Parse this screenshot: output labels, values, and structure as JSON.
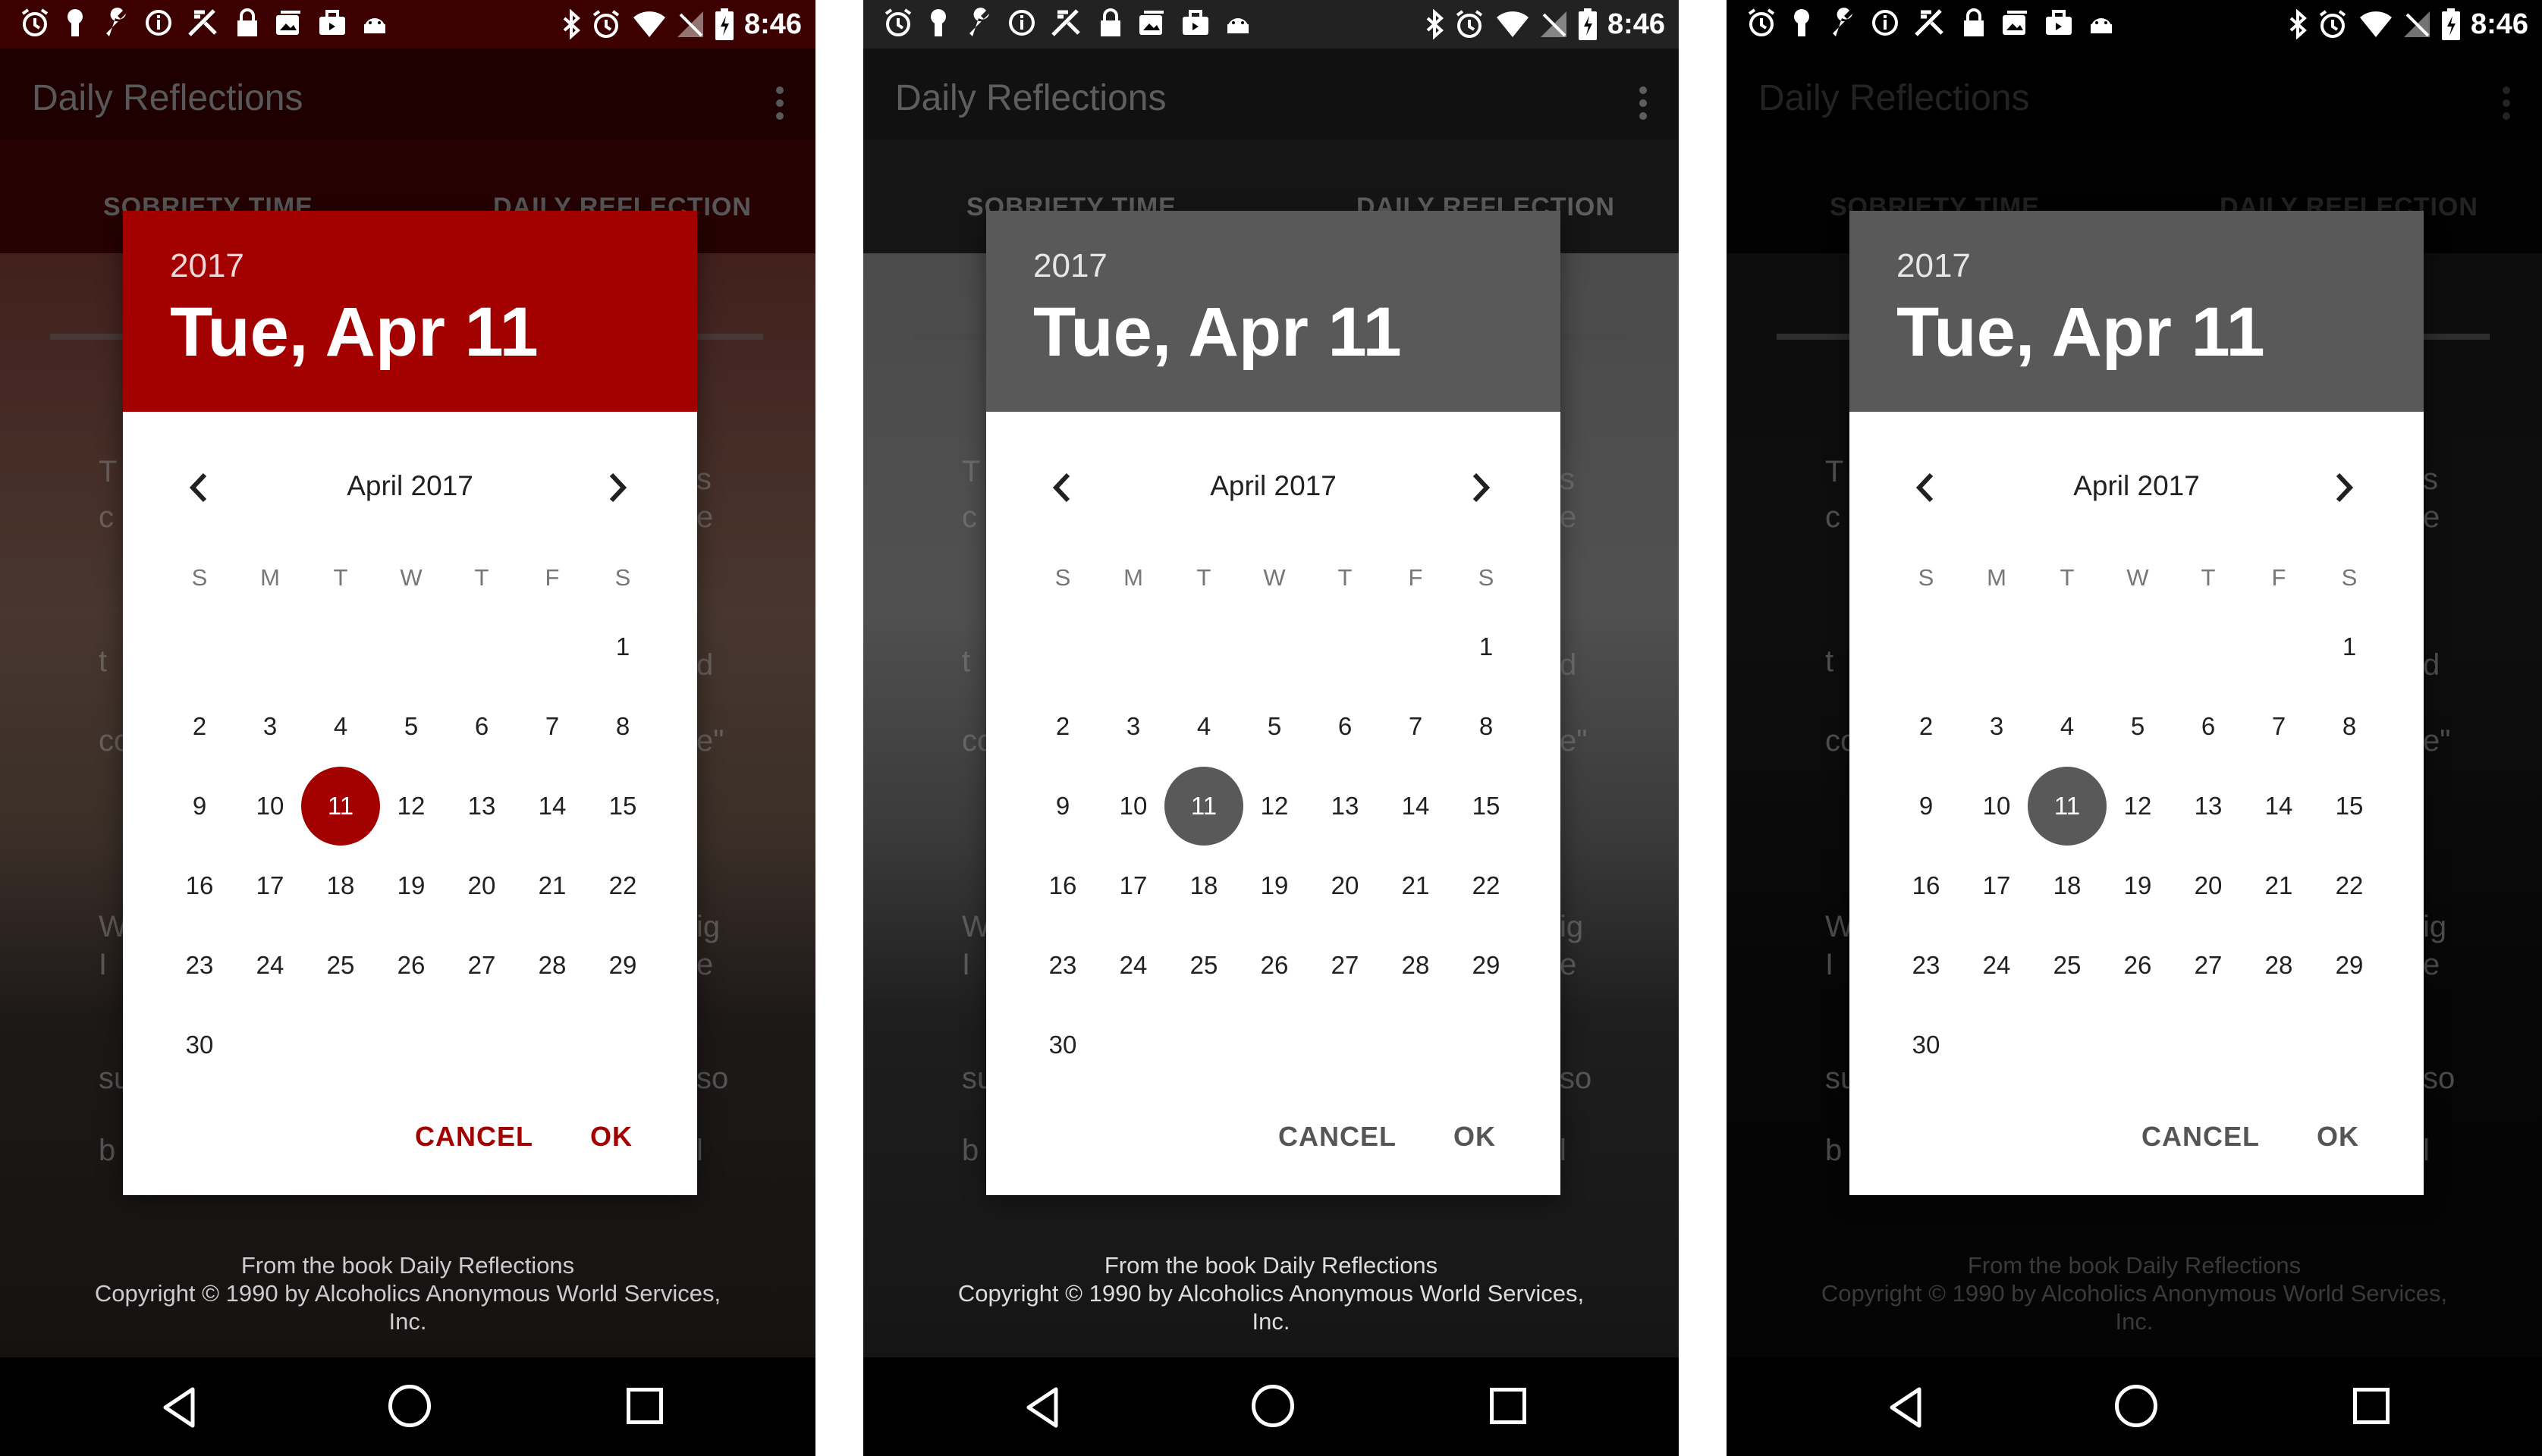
{
  "status_bar": {
    "time": "8:46"
  },
  "app": {
    "title": "Daily Reflections",
    "tabs": [
      "SOBRIETY TIME",
      "DAILY REFLECTION"
    ],
    "footer_lines": [
      "From the book Daily Reflections",
      "Copyright © 1990 by Alcoholics Anonymous World Services,",
      "Inc."
    ],
    "side_text_left": [
      "T",
      "c",
      "t",
      "co",
      "W",
      "I",
      "su",
      "b"
    ],
    "side_text_right": [
      "s",
      "e",
      "d",
      "e\"",
      "ig",
      "e",
      "so",
      "l"
    ]
  },
  "date_picker": {
    "year": "2017",
    "selected_date_label": "Tue, Apr 11",
    "month_label": "April 2017",
    "weekday_labels": [
      "S",
      "M",
      "T",
      "W",
      "T",
      "F",
      "S"
    ],
    "first_weekday_index": 6,
    "days_in_month": 30,
    "selected_day": 11,
    "cancel_label": "CANCEL",
    "ok_label": "OK"
  },
  "themes": [
    {
      "name": "red",
      "header_color": "#a30000",
      "selected_circle": "#a30000",
      "button_color": "#a30000",
      "appbar_color": "#3d0000",
      "tabs_color": "#4a0505",
      "footer_text": "#cccccc",
      "title_color": "#aaaaaa"
    },
    {
      "name": "gray",
      "header_color": "#595959",
      "selected_circle": "#595959",
      "button_color": "#555555",
      "appbar_color": "#222222",
      "tabs_color": "#2a2a2a",
      "footer_text": "#dddddd",
      "title_color": "#b5b5b5"
    },
    {
      "name": "dark",
      "header_color": "#595959",
      "selected_circle": "#595959",
      "button_color": "#555555",
      "appbar_color": "#000000",
      "tabs_color": "#050505",
      "footer_text": "#3a3a3a",
      "title_color": "#444444"
    }
  ]
}
